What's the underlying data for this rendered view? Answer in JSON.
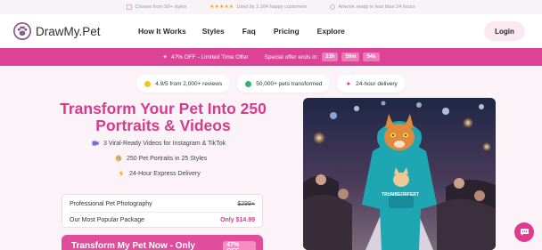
{
  "topbar": {
    "items": [
      {
        "icon": "check-square-icon",
        "text": "Choose from 50+ styles"
      },
      {
        "icon": "stars-icon",
        "stars": "★★★★★",
        "text": "Used by 2,164 happy customers"
      },
      {
        "icon": "clock-icon",
        "text": "Artwork ready in less than 24 hours"
      }
    ]
  },
  "nav": {
    "brand": "DrawMy.Pet",
    "links": [
      "How It Works",
      "Styles",
      "Faq",
      "Pricing",
      "Explore"
    ],
    "login": "Login"
  },
  "promo": {
    "offer": "47% OFF - Limited Time Offer",
    "ends_label": "Special offer ends in:",
    "timer": [
      "23h",
      "59m",
      "54s"
    ]
  },
  "badges": [
    {
      "icon": "star-badge-icon",
      "color": "#f5c518",
      "text": "4.9/5 from 2,000+ reviews"
    },
    {
      "icon": "check-badge-icon",
      "color": "#2bb673",
      "text": "50,000+ pets transformed"
    },
    {
      "icon": "sparkle-icon",
      "color": "#e0398f",
      "text": "24-hour delivery"
    }
  ],
  "hero": {
    "title": "Transform Your Pet Into 250 Portraits & Videos",
    "features": [
      {
        "icon": "video-icon",
        "text": "3 Viral-Ready Videos for Instagram & TikTok"
      },
      {
        "icon": "palette-icon",
        "text": "250 Pet Portraits in 25 Styles"
      },
      {
        "icon": "lightning-icon",
        "text": "24-Hour Express Delivery"
      }
    ]
  },
  "pricing": {
    "row1_label": "Professional Pet Photography",
    "row1_price": "$299+",
    "row2_label": "Our Most Popular Package",
    "row2_price": "Only $14.99"
  },
  "cta": {
    "label": "Transform My Pet Now - Only $14.99",
    "badge": "47% OFF"
  },
  "image": {
    "hoodie_text": "TRUMBEORFERT"
  },
  "colors": {
    "accent": "#dc4296",
    "title": "#d63b8c",
    "cta": "#e04d9d"
  }
}
